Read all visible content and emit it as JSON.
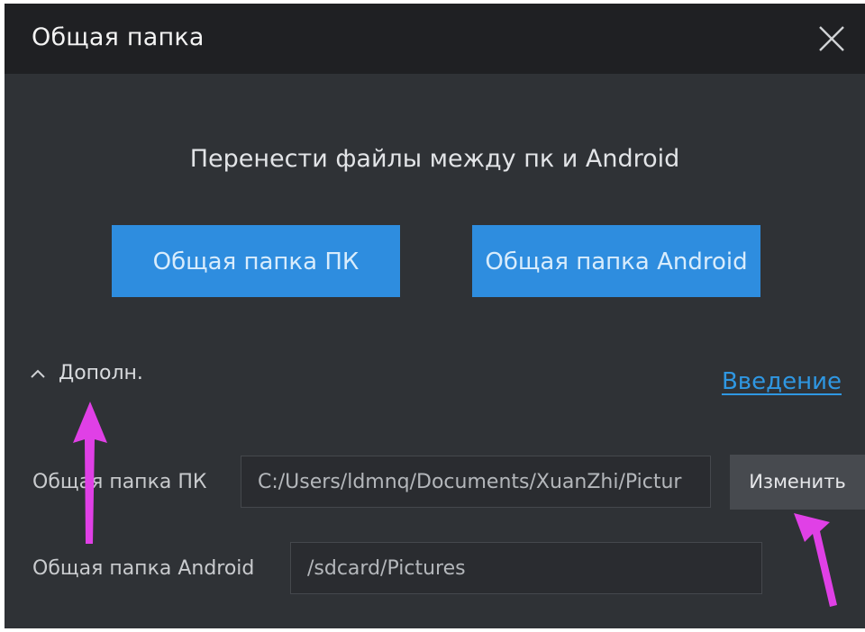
{
  "window": {
    "title": "Общая папка",
    "close_icon": "close-icon"
  },
  "main": {
    "subtitle": "Перенести файлы между пк и Android",
    "pc_folder_button": "Общая папка ПК",
    "android_folder_button": "Общая папка Android",
    "accent_color": "#2e8ddf"
  },
  "advanced": {
    "toggle_label": "Дополн.",
    "toggle_icon": "chevron-up-icon",
    "intro_link": "Введение",
    "pc_folder": {
      "label": "Общая папка ПК",
      "value": "C:/Users/ldmnq/Documents/XuanZhi/Pictur",
      "change_button": "Изменить"
    },
    "android_folder": {
      "label": "Общая папка Android",
      "value": "/sdcard/Pictures"
    }
  },
  "annotations": {
    "arrow_color": "#e040e6",
    "arrow_icon": "pointer-arrow-icon"
  }
}
